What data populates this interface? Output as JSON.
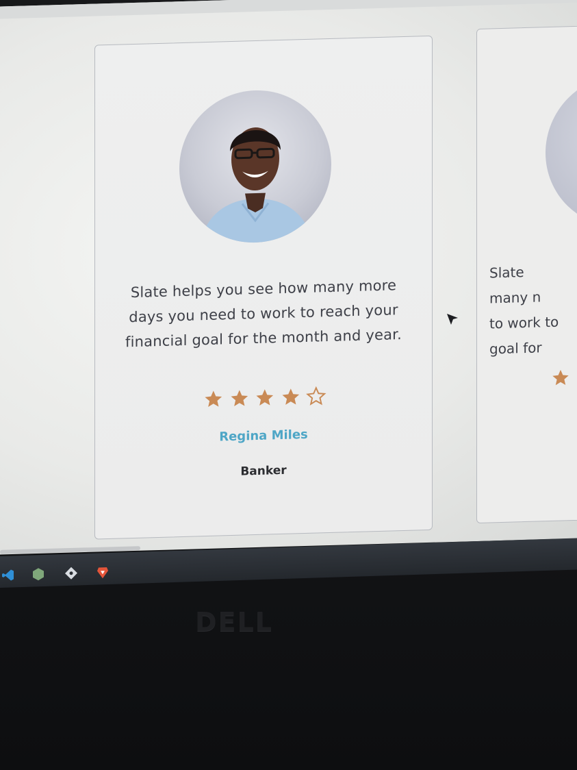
{
  "testimonial": {
    "quote": "Slate helps you see how many more days you need to work to reach your financial goal for the month and year.",
    "rating": 4,
    "rating_max": 5,
    "reviewer_name": "Regina Miles",
    "reviewer_role": "Banker"
  },
  "next_card_partial": {
    "quote_fragment": "Slate \nmany n\nto work to\ngoal for"
  },
  "monitor": {
    "brand": "DELL"
  },
  "colors": {
    "star_fill": "#c98a55",
    "star_outline": "#c98a55",
    "name_accent": "#4ea6c6",
    "role_text": "#2c2d31",
    "body_text": "#3e4048"
  },
  "icons": [
    "user-avatar",
    "star-filled-icon",
    "star-outline-icon",
    "mouse-cursor-icon",
    "vscode-icon",
    "node-icon",
    "git-icon",
    "brave-icon"
  ]
}
